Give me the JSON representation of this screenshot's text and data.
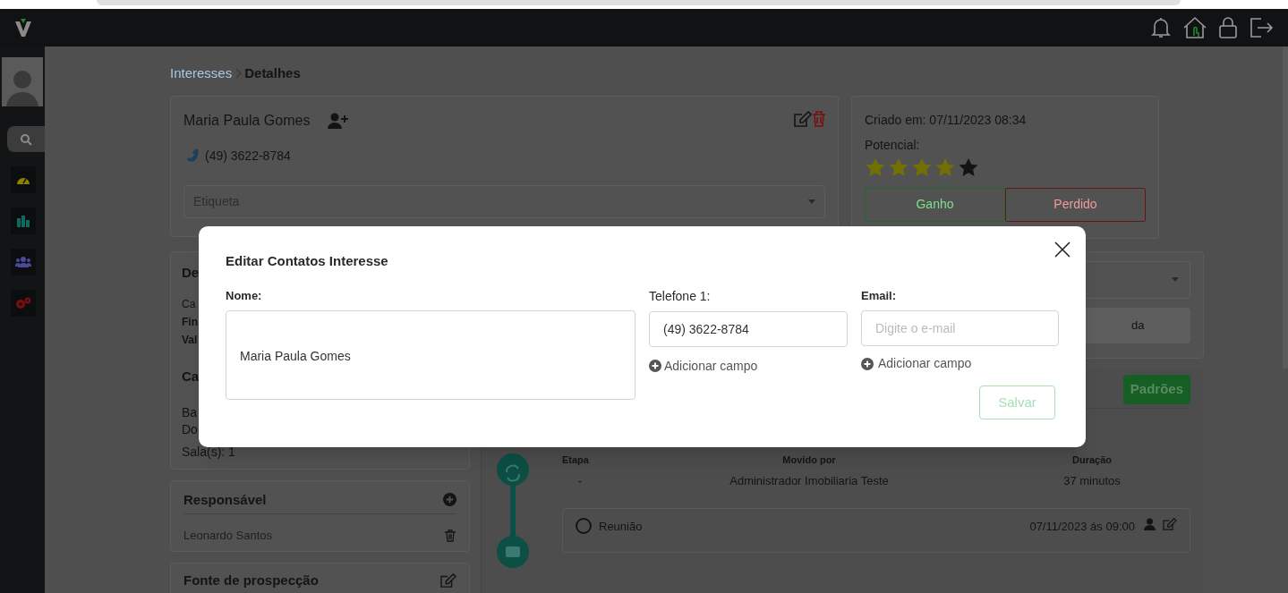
{
  "breadcrumb": {
    "parent": "Interesses",
    "current": "Detalhes"
  },
  "contact_card": {
    "name": "Maria Paula Gomes",
    "phone": "(49) 3622-8784",
    "tag_select": {
      "placeholder": "Etiqueta"
    }
  },
  "status_card": {
    "created": "Criado em: 07/11/2023 08:34",
    "potential_label": "Potencial:",
    "stars": 4,
    "buttons": [
      {
        "label": "Ganho",
        "kind": "won"
      },
      {
        "label": "Perdido",
        "kind": "lost"
      }
    ]
  },
  "details_card": {
    "title": "De",
    "lines": [
      {
        "text": "Ca",
        "bold": false
      },
      {
        "text": "Fin",
        "bold": true
      },
      {
        "text": "Val",
        "bold": true
      }
    ]
  },
  "features_card": {
    "title": "Ca",
    "lines": [
      "Ba",
      "Do",
      "Sala(s): 1"
    ]
  },
  "responsible_card": {
    "title": "Responsável",
    "person": "Leonardo Santos"
  },
  "source_card": {
    "title": "Fonte de prospecção"
  },
  "side_panel": {
    "fragment": "da"
  },
  "actions_card": {
    "button": "Padrões"
  },
  "timeline": {
    "columns": [
      "Etapa",
      "Movido por",
      "Duração"
    ],
    "row": [
      "-",
      "Administrador Imobiliaria Teste",
      "37 minutos"
    ],
    "events": [
      {
        "title": "Reunião",
        "datetime": "07/11/2023 ás 09:00",
        "done": false
      }
    ]
  },
  "modal": {
    "title": "Editar Contatos Interesse",
    "name_label": "Nome:",
    "name_value": "Maria Paula Gomes",
    "phone_label": "Telefone 1:",
    "phone_value": "(49) 3622-8784",
    "email_label": "Email:",
    "email_placeholder": "Digite o e-mail",
    "add_field": [
      "Adicionar campo",
      "Adicionar campo"
    ],
    "save": "Salvar",
    "save_disabled": true
  }
}
